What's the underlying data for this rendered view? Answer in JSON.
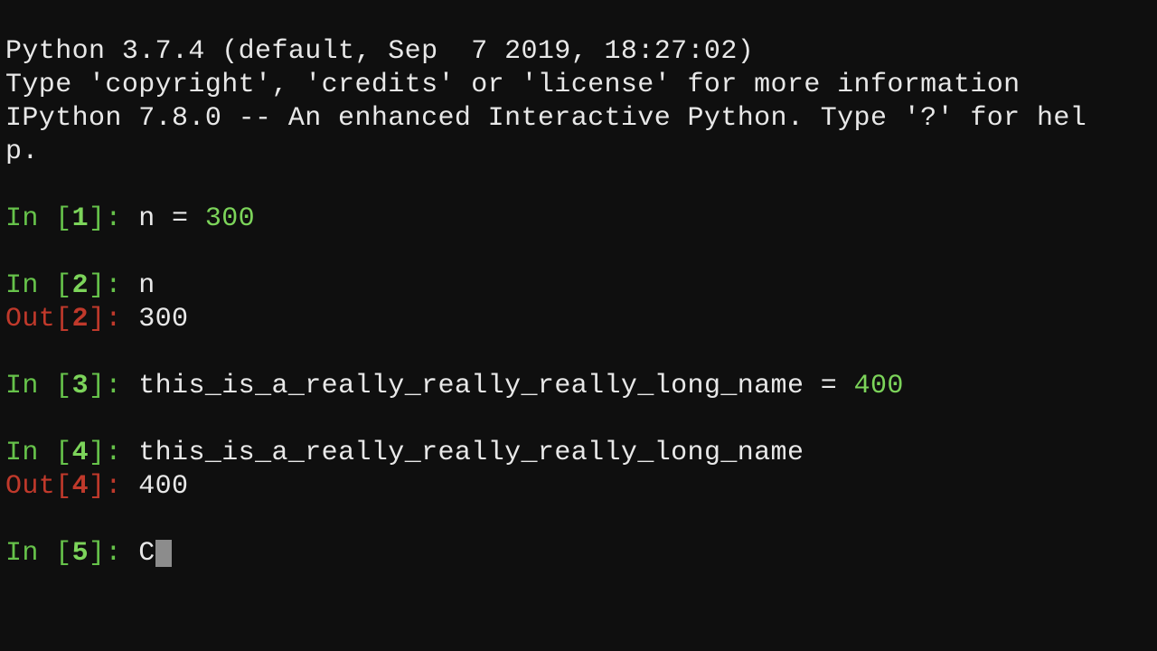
{
  "banner": {
    "line1": "Python 3.7.4 (default, Sep  7 2019, 18:27:02)",
    "line2": "Type 'copyright', 'credits' or 'license' for more information",
    "line3": "IPython 7.8.0 -- An enhanced Interactive Python. Type '?' for hel",
    "line4": "p."
  },
  "prompt": {
    "in_word": "In ",
    "out_word": "Out",
    "lbrk": "[",
    "rbrk_colon": "]: ",
    "rbrk_colon_tight": "]:"
  },
  "cells": {
    "c1": {
      "n": "1",
      "code_pre": "n = ",
      "lit": "300"
    },
    "c2": {
      "n": "2",
      "code": "n",
      "out": "300"
    },
    "c3": {
      "n": "3",
      "code_pre": "this_is_a_really_really_really_long_name = ",
      "lit": "400"
    },
    "c4": {
      "n": "4",
      "code": "this_is_a_really_really_really_long_name",
      "out": "400"
    },
    "c5": {
      "n": "5",
      "partial": "C"
    }
  }
}
